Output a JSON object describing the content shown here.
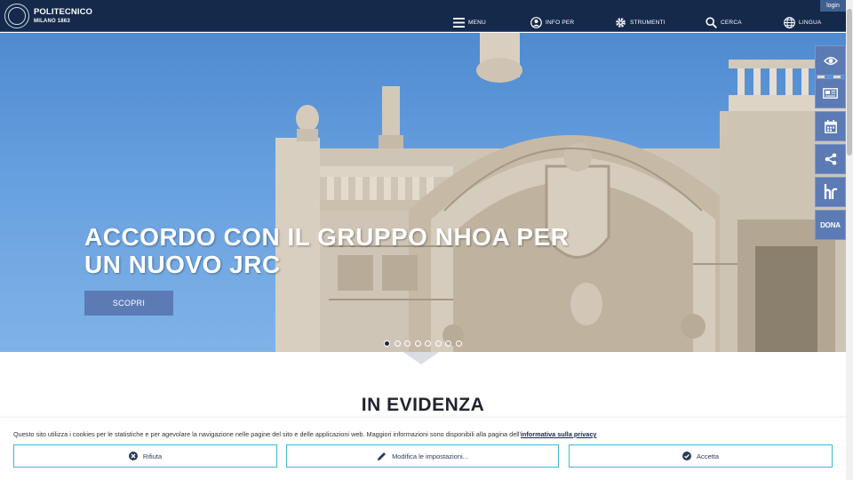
{
  "header": {
    "logo_line1": "POLITECNICO",
    "logo_line2": "MILANO 1863",
    "login": "login",
    "nav": [
      {
        "label": "MENU",
        "icon": "hamburger-icon"
      },
      {
        "label": "INFO PER",
        "icon": "user-icon"
      },
      {
        "label": "STRUMENTI",
        "icon": "gear-icon"
      },
      {
        "label": "CERCA",
        "icon": "search-icon"
      },
      {
        "label": "LINGUA",
        "icon": "globe-icon"
      }
    ]
  },
  "hero": {
    "title_line1": "ACCORDO CON IL GRUPPO NHOA PER",
    "title_line2": "UN NUOVO JRC",
    "button": "SCOPRI",
    "slides_total": 8,
    "active_slide": 1
  },
  "sidebar": {
    "items": [
      "eye-icon",
      "news-icon",
      "calendar-icon",
      "share-icon",
      "hr-icon"
    ],
    "dona": "DONA"
  },
  "section": {
    "title": "IN EVIDENZA"
  },
  "cookie": {
    "text": "Questo sito utilizza i cookies per le statistiche e per agevolare la navigazione nelle pagine del sito e delle applicazioni web. Maggiori informazioni sono disponibili alla pagina dell'",
    "link": "informativa sulla privacy",
    "buttons": {
      "reject": "Rifiuta",
      "settings": "Modifica le impostazioni...",
      "accept": "Accetta"
    }
  },
  "colors": {
    "header_bg": "#15294b",
    "accent": "#5c7bb4",
    "cookie_border": "#3fb7d1"
  }
}
